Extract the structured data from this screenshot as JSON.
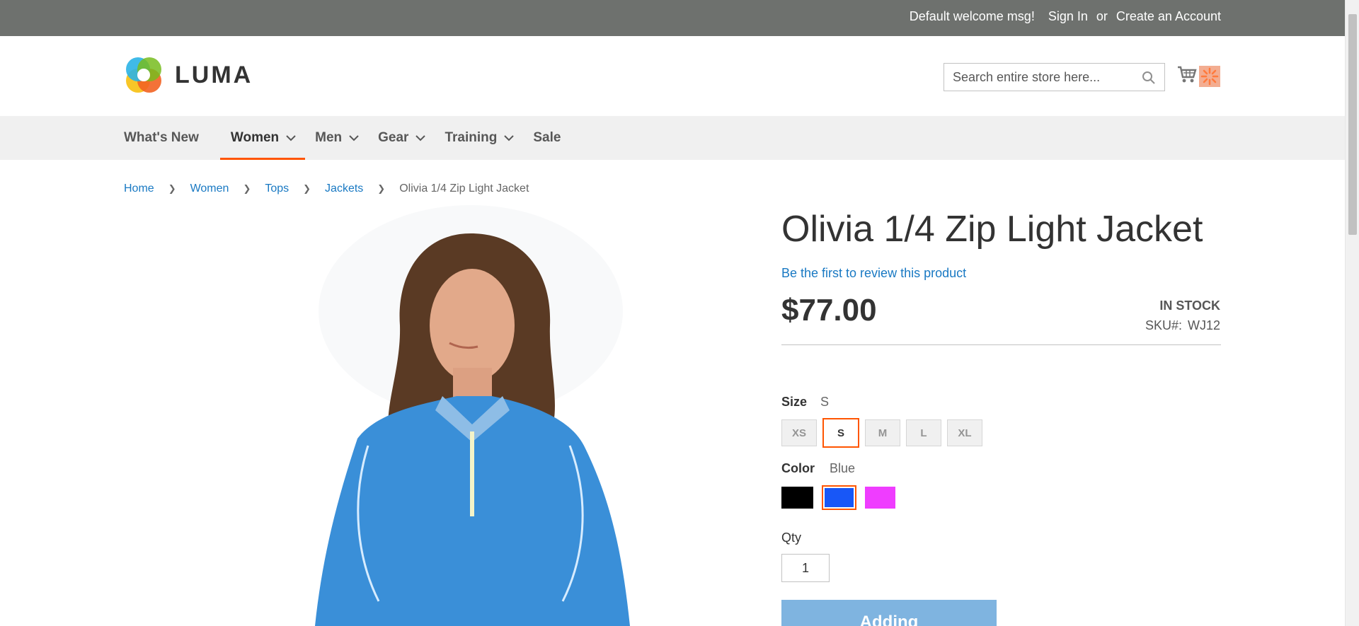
{
  "header_panel": {
    "welcome": "Default welcome msg!",
    "sign_in": "Sign In",
    "or": "or",
    "create_account": "Create an Account"
  },
  "logo": {
    "text": "LUMA"
  },
  "search": {
    "placeholder": "Search entire store here..."
  },
  "nav": {
    "items": [
      {
        "label": "What's New",
        "has_dropdown": false
      },
      {
        "label": "Women",
        "has_dropdown": true,
        "active": true
      },
      {
        "label": "Men",
        "has_dropdown": true
      },
      {
        "label": "Gear",
        "has_dropdown": true
      },
      {
        "label": "Training",
        "has_dropdown": true
      },
      {
        "label": "Sale",
        "has_dropdown": false
      }
    ]
  },
  "breadcrumb": {
    "items": [
      "Home",
      "Women",
      "Tops",
      "Jackets"
    ],
    "current": "Olivia 1/4 Zip Light Jacket"
  },
  "product": {
    "title": "Olivia 1/4 Zip Light Jacket",
    "review_link": "Be the first to review this product",
    "price": "$77.00",
    "stock": "IN STOCK",
    "sku_label": "SKU#:",
    "sku": "WJ12",
    "size_label": "Size",
    "size_selected": "S",
    "sizes": [
      "XS",
      "S",
      "M",
      "L",
      "XL"
    ],
    "color_label": "Color",
    "color_selected": "Blue",
    "colors": [
      "#000000",
      "#1857f7",
      "#ef3dff"
    ],
    "qty_label": "Qty",
    "qty": "1",
    "add_button": "Adding"
  },
  "colors": {
    "accent": "#ff5501",
    "link": "#1979c3",
    "panel": "#6e716e"
  }
}
